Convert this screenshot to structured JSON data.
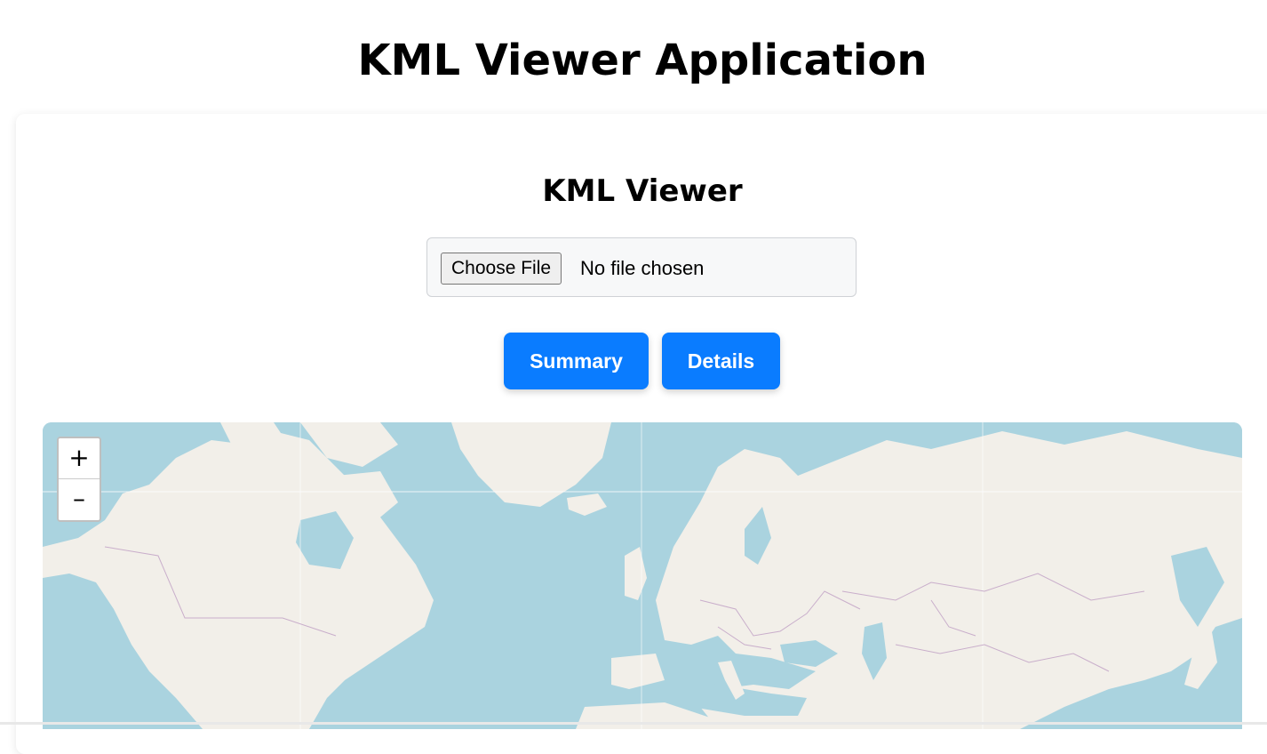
{
  "page": {
    "title": "KML Viewer Application"
  },
  "viewer": {
    "title": "KML Viewer",
    "file_input": {
      "button_label": "Choose File",
      "status": "No file chosen"
    },
    "buttons": {
      "summary": "Summary",
      "details": "Details"
    }
  },
  "map": {
    "zoom_in": "+",
    "zoom_out": "–",
    "colors": {
      "water": "#aad3df",
      "land": "#f2efe9",
      "border": "#c9aecb",
      "accent": "#0a7cff"
    }
  }
}
